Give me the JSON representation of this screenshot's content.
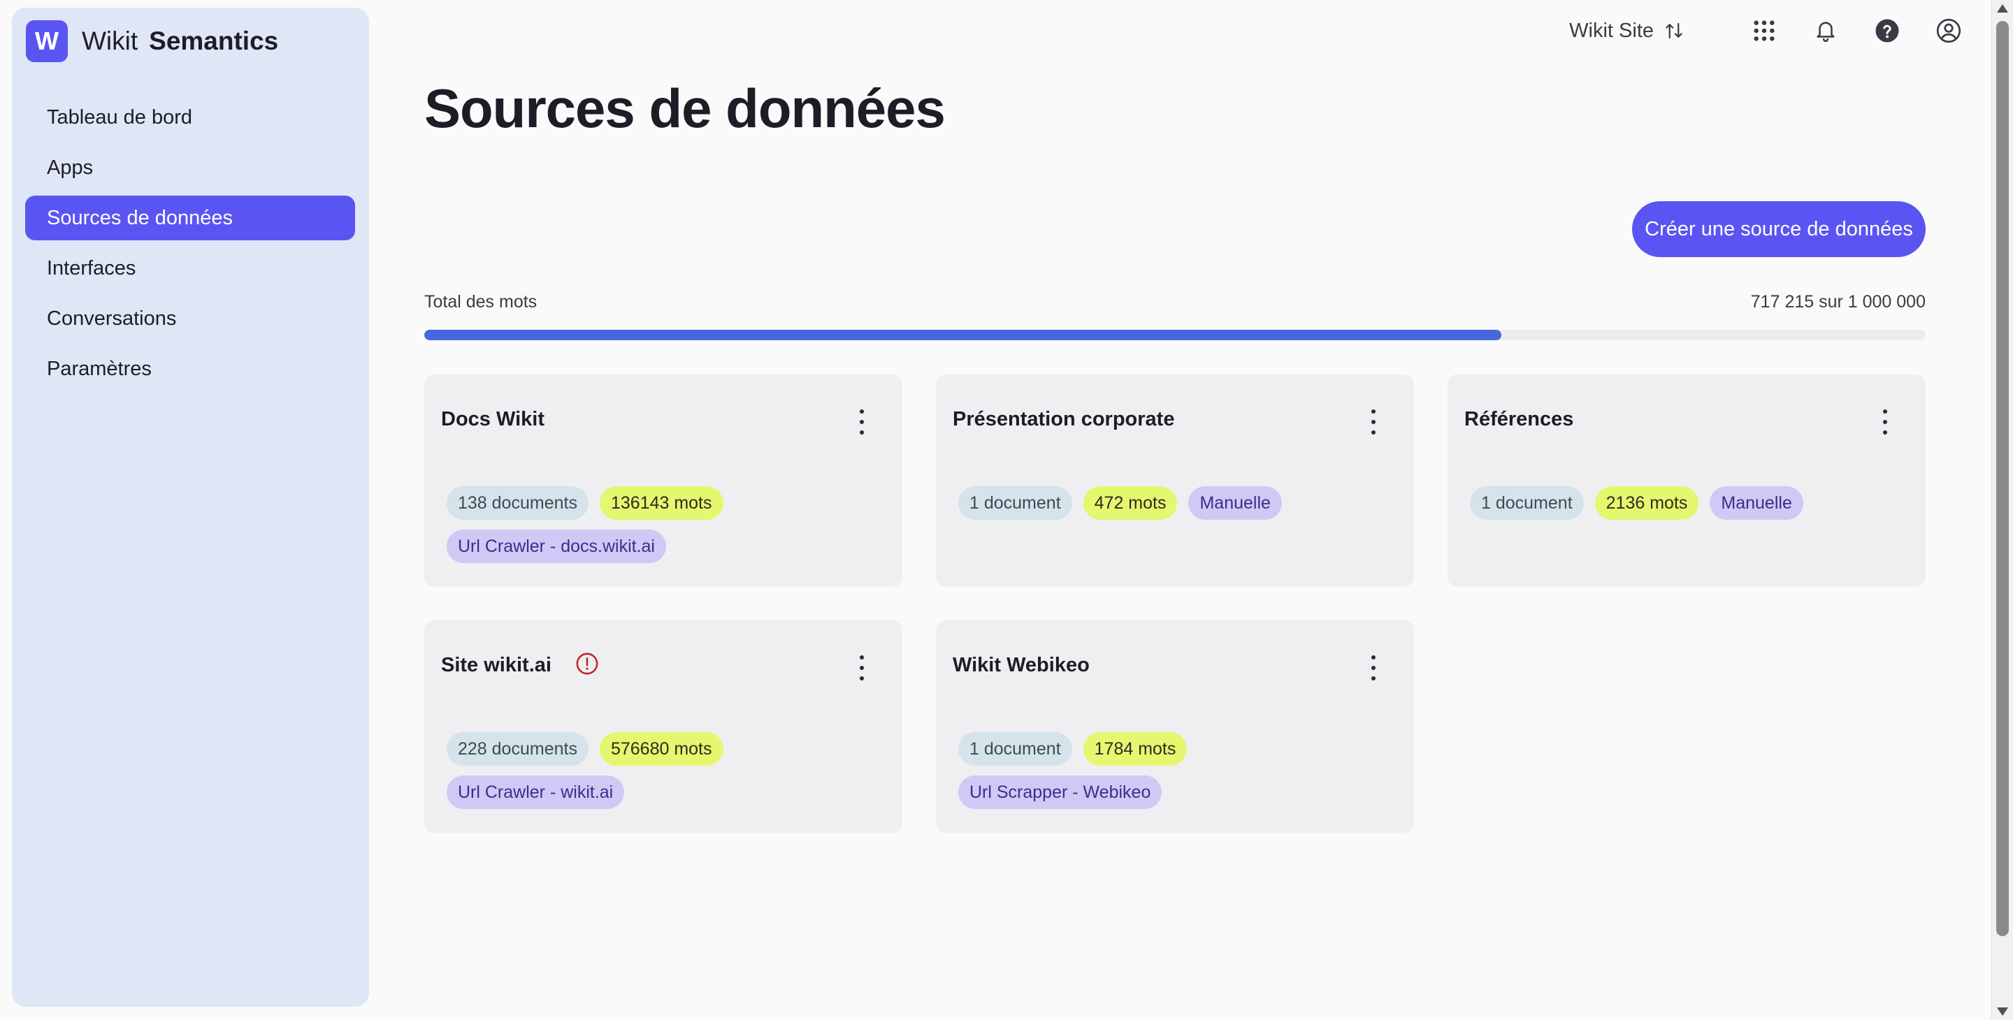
{
  "app": {
    "brand_initial": "W",
    "brand_name_1": "Wikit",
    "brand_name_2": "Semantics"
  },
  "sidebar": {
    "items": [
      {
        "label": "Tableau de bord"
      },
      {
        "label": "Apps"
      },
      {
        "label": "Sources de données",
        "active": true
      },
      {
        "label": "Interfaces"
      },
      {
        "label": "Conversations"
      },
      {
        "label": "Paramètres"
      }
    ]
  },
  "topbar": {
    "site_label": "Wikit Site",
    "icons": [
      "sort-arrows-icon",
      "apps-grid-icon",
      "bell-icon",
      "help-icon",
      "user-icon"
    ]
  },
  "page": {
    "title": "Sources de données",
    "create_button": "Créer une source de données",
    "words_label": "Total des mots",
    "words_count": "717 215 sur 1 000 000",
    "words_used": 717215,
    "words_max": 1000000
  },
  "cards": [
    {
      "title": "Docs Wikit",
      "warning": false,
      "badges": {
        "docs": "138 documents",
        "words": "136143 mots",
        "source": "Url Crawler - docs.wikit.ai"
      }
    },
    {
      "title": "Présentation corporate",
      "warning": false,
      "badges": {
        "docs": "1 document",
        "words": "472 mots",
        "source": "Manuelle"
      }
    },
    {
      "title": "Références",
      "warning": false,
      "badges": {
        "docs": "1 document",
        "words": "2136 mots",
        "source": "Manuelle"
      }
    },
    {
      "title": "Site wikit.ai",
      "warning": true,
      "badges": {
        "docs": "228 documents",
        "words": "576680 mots",
        "source": "Url Crawler - wikit.ai"
      }
    },
    {
      "title": "Wikit Webikeo",
      "warning": false,
      "badges": {
        "docs": "1 document",
        "words": "1784 mots",
        "source": "Url Scrapper - Webikeo"
      }
    }
  ],
  "colors": {
    "accent": "#5a55f2",
    "progress": "#4667e0",
    "warning": "#c0262d"
  }
}
